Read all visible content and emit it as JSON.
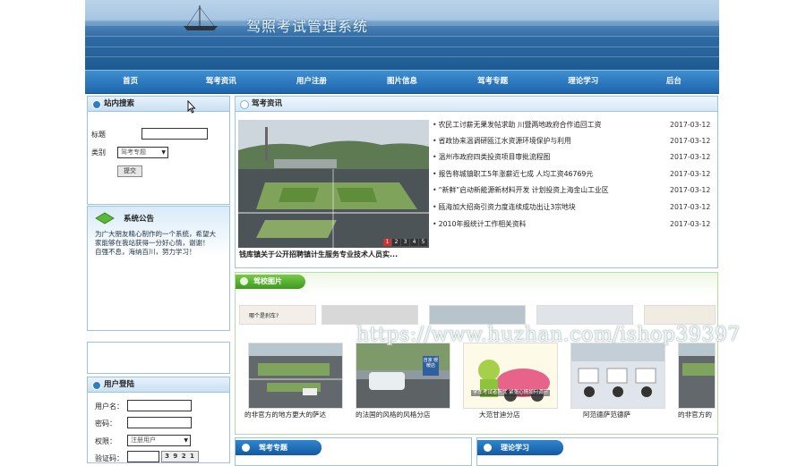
{
  "site": {
    "title": "驾照考试管理系统"
  },
  "nav": [
    "首页",
    "驾考资讯",
    "用户注册",
    "图片信息",
    "驾考专题",
    "理论学习",
    "后台"
  ],
  "search": {
    "heading": "站内搜索",
    "title_label": "标题",
    "title_value": "",
    "category_label": "类别",
    "category_value": "驾考专题",
    "submit_label": "提交"
  },
  "notice": {
    "heading": "系统公告",
    "text": "为广大朋友精心制作的一个系统，希望大家能够在我站获得一分好心情，谢谢！　　自强不息，海纳百川，努力学习！"
  },
  "login": {
    "heading": "用户登陆",
    "username_label": "用户名：",
    "password_label": "密码：",
    "role_label": "权限：",
    "role_value": "注册用户",
    "captcha_label": "验证码：",
    "captcha_text": "3 9 2 1"
  },
  "news": {
    "heading": "驾考资讯",
    "featured_caption": "钱库镇关于公开招聘镇计生服务专业技术人员实...",
    "slide_dots": [
      "1",
      "2",
      "3",
      "4",
      "5"
    ],
    "items": [
      {
        "title": "农民工讨薪无果发帖求助 川暨两地政府合作追回工资",
        "date": "2017-03-12"
      },
      {
        "title": "省政协来温调研瓯江水资源环境保护与利用",
        "date": "2017-03-12"
      },
      {
        "title": "温州市政府四类投资项目审批流程图",
        "date": "2017-03-12"
      },
      {
        "title": "报告称城镇职工5年涨薪近七成 人均工资46769元",
        "date": "2017-03-12"
      },
      {
        "title": "“新鲜”启动新能源新材料开发 计划投资上海金山工业区",
        "date": "2017-03-12"
      },
      {
        "title": "瓯海加大招商引资力度连续成功出让3宗地块",
        "date": "2017-03-12"
      },
      {
        "title": "2010年报统计工作相关资料",
        "date": "2017-03-12"
      }
    ]
  },
  "gallery": {
    "heading": "驾校图片",
    "top_row_labels": [
      "哪个是刹车?"
    ],
    "items": [
      {
        "caption": "的非官方的地方更大的萨达"
      },
      {
        "caption": "的法国的风格的风格分店"
      },
      {
        "caption": "大范甘迪分店",
        "overlay": "学车考试者担忧 紧张心情如何调节"
      },
      {
        "caption": "阿范德萨范德萨"
      },
      {
        "caption": "的非官方的"
      }
    ],
    "road_sign": "自家 暖暖店"
  },
  "sections": {
    "topic": "驾考专题",
    "theory": "理论学习"
  },
  "watermark": "https://www.huzhan.com/ishop39397"
}
